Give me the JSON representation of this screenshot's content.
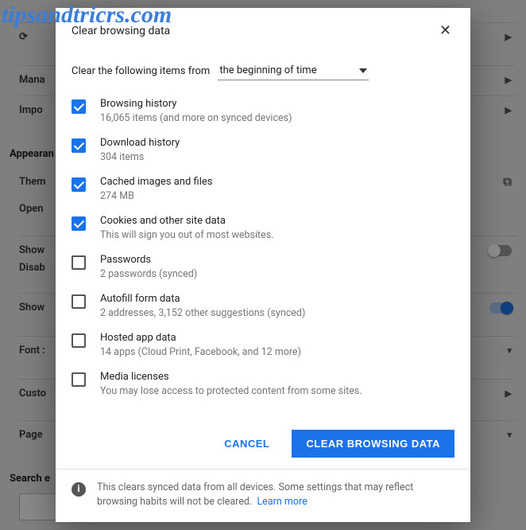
{
  "watermark": "tipsandtricrs.com",
  "dialog": {
    "title": "Clear browsing data",
    "from_label": "Clear the following items from",
    "time_range": "the beginning of time",
    "options": [
      {
        "checked": true,
        "label": "Browsing history",
        "desc": "16,065 items (and more on synced devices)"
      },
      {
        "checked": true,
        "label": "Download history",
        "desc": "304 items"
      },
      {
        "checked": true,
        "label": "Cached images and files",
        "desc": "274 MB"
      },
      {
        "checked": true,
        "label": "Cookies and other site data",
        "desc": "This will sign you out of most websites."
      },
      {
        "checked": false,
        "label": "Passwords",
        "desc": "2 passwords (synced)"
      },
      {
        "checked": false,
        "label": "Autofill form data",
        "desc": "2 addresses, 3,152 other suggestions (synced)"
      },
      {
        "checked": false,
        "label": "Hosted app data",
        "desc": "14 apps (Cloud Print, Facebook, and 12 more)"
      },
      {
        "checked": false,
        "label": "Media licenses",
        "desc": "You may lose access to protected content from some sites."
      }
    ],
    "cancel": "CANCEL",
    "confirm": "CLEAR BROWSING DATA",
    "footer_note": "This clears synced data from all devices. Some settings that may reflect browsing habits will not be cleared.",
    "learn_more": "Learn more"
  },
  "background": {
    "rows": {
      "mana": "Mana",
      "impo": "Impo"
    },
    "appearance": "Appearan",
    "them": "Them",
    "open": "Open",
    "show1": "Show",
    "disab": "Disab",
    "show2": "Show",
    "font": "Font :",
    "custo": "Custo",
    "page": "Page",
    "search": "Search e",
    "searc_sel": "Searc"
  }
}
